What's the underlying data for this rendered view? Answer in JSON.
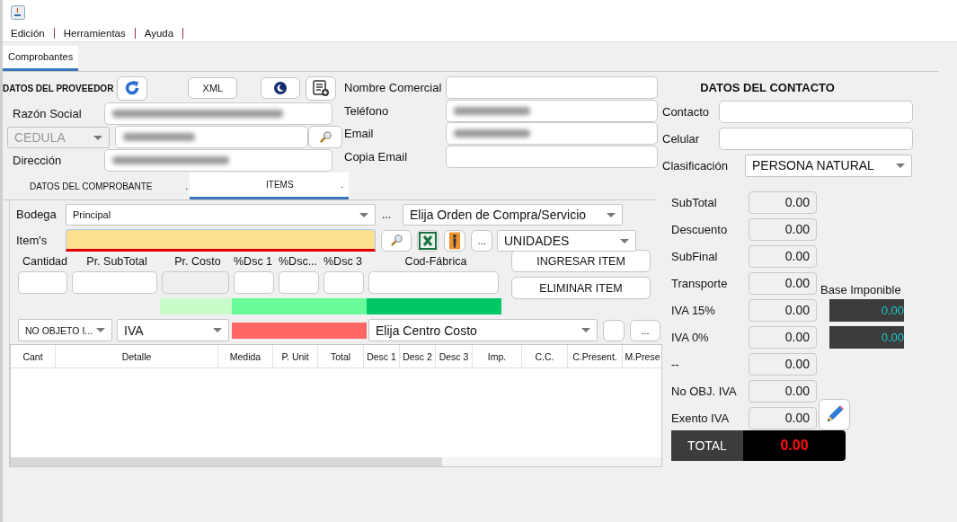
{
  "menu": [
    "Edición",
    "Herramientas",
    "Ayuda"
  ],
  "tabs": [
    {
      "label": "Comprobantes",
      "selected": true
    }
  ],
  "proveedor": {
    "heading": "DATOS DEL PROVEEDOR",
    "xml_button": "XML",
    "razon_social": {
      "label": "Razón Social",
      "redacted": true
    },
    "id_type": {
      "value": "CEDULA",
      "disabled": true
    },
    "id_number": {
      "redacted": true
    },
    "direccion": {
      "label": "Dirección",
      "redacted": true
    }
  },
  "extra_fields": [
    {
      "label": "Nombre Comercial",
      "redacted": false
    },
    {
      "label": "Teléfono",
      "redacted": true
    },
    {
      "label": "Email",
      "redacted": true
    },
    {
      "label": "Copia Email",
      "redacted": false
    }
  ],
  "contacto": {
    "heading": "DATOS DEL CONTACTO",
    "fields": [
      {
        "label": "Contacto"
      },
      {
        "label": "Celular"
      }
    ],
    "clasificacion": {
      "label": "Clasificación",
      "value": "PERSONA NATURAL"
    }
  },
  "subtabs": [
    {
      "label": "DATOS DEL COMPROBANTE",
      "marker": ".",
      "selected": false
    },
    {
      "label": "ITEMS",
      "marker": ".",
      "selected": true
    }
  ],
  "items": {
    "bodega": {
      "label": "Bodega",
      "value": "Principal"
    },
    "bodega_more": "...",
    "orden": "Elija Orden de Compra/Servicio",
    "item": {
      "label": "Item's"
    },
    "more_button": "...",
    "unidades": "UNIDADES",
    "entries": [
      {
        "label": "Cantidad",
        "disabled": false
      },
      {
        "label": "Pr. SubTotal",
        "disabled": false
      },
      {
        "label": "Pr. Costo",
        "disabled": true
      },
      {
        "label": "%Dsc 1",
        "disabled": false
      },
      {
        "label": "%Dsc...",
        "disabled": false
      },
      {
        "label": "%Dsc 3",
        "disabled": false
      },
      {
        "label": "Cod-Fábrica",
        "disabled": false
      }
    ],
    "actions": [
      "INGRESAR ITEM",
      "ELIMINAR ITEM"
    ],
    "bars": [
      {
        "color": "#c8fcc8"
      },
      {
        "color": "#6afc9a"
      },
      {
        "color": "#00c864"
      }
    ],
    "tax_type": "NO OBJETO I...",
    "iva": "IVA",
    "iva_bar": {
      "color": "#ff6666"
    },
    "centro_costo": "Elija Centro Costo",
    "cc_more": "..."
  },
  "table": {
    "columns": [
      "Cant",
      "Detalle",
      "Medida",
      "P. Unit",
      "Total",
      "Desc 1",
      "Desc 2",
      "Desc 3",
      "Imp.",
      "C.C.",
      "C.Present.",
      "M.Prese"
    ]
  },
  "totals": [
    {
      "label": "SubTotal",
      "value": "0.00"
    },
    {
      "label": "Descuento",
      "value": "0.00"
    },
    {
      "label": "SubFinal",
      "value": "0.00"
    },
    {
      "label": "Transporte",
      "value": "0.00"
    },
    {
      "label": "IVA 15%",
      "value": "0.00"
    },
    {
      "label": "IVA 0%",
      "value": "0.00"
    },
    {
      "label": "--",
      "value": "0.00"
    },
    {
      "label": "No OBJ. IVA",
      "value": "0.00"
    },
    {
      "label": "Exento IVA",
      "value": "0.00"
    }
  ],
  "base_imponible": {
    "label": "Base Imponible",
    "values": [
      "0.00",
      "0.00"
    ]
  },
  "total": {
    "label": "TOTAL",
    "value": "0.00"
  }
}
